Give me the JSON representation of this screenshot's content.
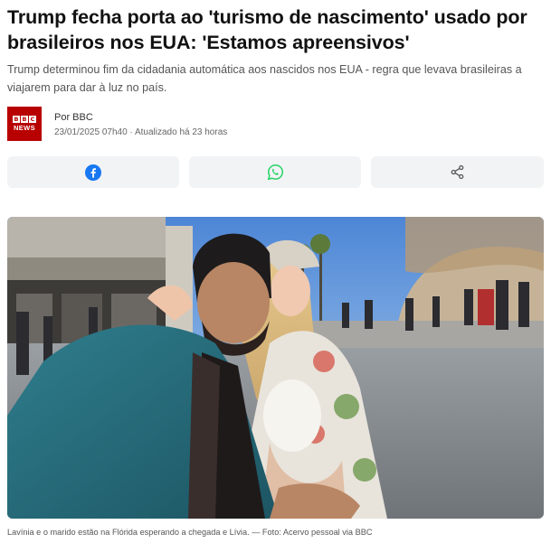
{
  "article": {
    "headline": "Trump fecha porta ao 'turismo de nascimento' usado por brasileiros nos EUA: 'Estamos apreensivos'",
    "subtitle": "Trump determinou fim da cidadania automática aos nascidos nos EUA - regra que levava brasileiras a viajarem para dar à luz no país."
  },
  "byline": {
    "logo_letters": [
      "B",
      "B",
      "C"
    ],
    "logo_word": "NEWS",
    "author": "Por BBC",
    "date": "23/01/2025 07h40 · Atualizado há 23 horas"
  },
  "share": {
    "buttons": [
      {
        "icon": "facebook-icon",
        "color": "#1877f2"
      },
      {
        "icon": "whatsapp-icon",
        "color": "#25d366"
      },
      {
        "icon": "share-icon",
        "color": "#555555"
      }
    ]
  },
  "photo": {
    "caption": "Lavínia e o marido estão na Flórida esperando a chegada e Lívia. — Foto: Acervo pessoal via BBC"
  },
  "colors": {
    "brand": "#b80000",
    "button_bg": "#f2f3f5"
  }
}
